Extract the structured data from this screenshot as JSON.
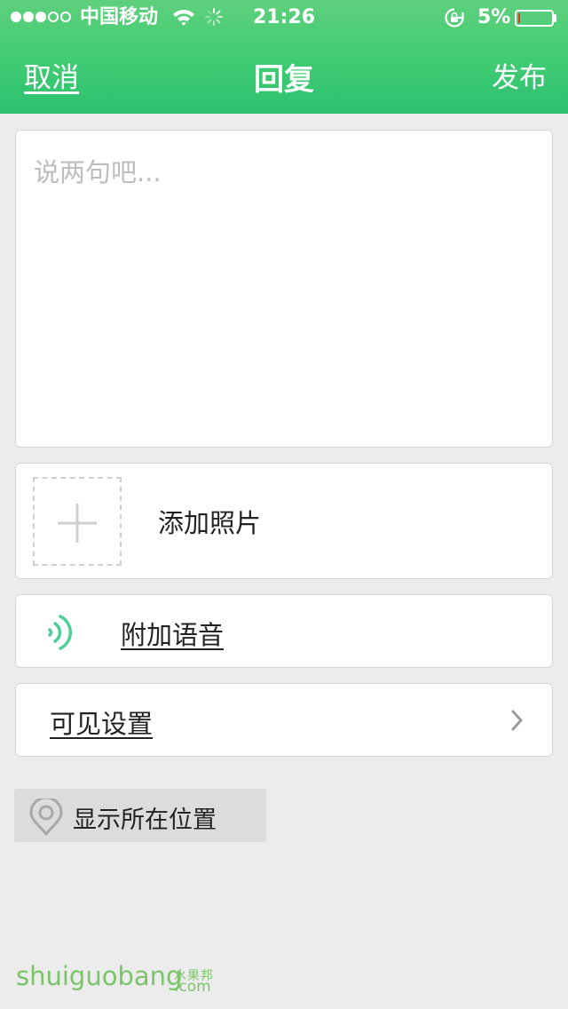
{
  "status_bar": {
    "carrier": "中国移动",
    "time": "21:26",
    "battery_percent": "5%",
    "battery_level": 0.05,
    "signal_bars_filled": 3,
    "signal_bars_total": 5
  },
  "nav": {
    "cancel_label": "取消",
    "title": "回复",
    "publish_label": "发布"
  },
  "compose": {
    "placeholder": "说两句吧...",
    "value": ""
  },
  "photo": {
    "label": "添加照片"
  },
  "voice": {
    "label": "附加语音"
  },
  "visibility": {
    "label": "可见设置"
  },
  "location": {
    "label": "显示所在位置"
  },
  "watermark": {
    "text": "shuiguobang",
    "cn_text": "水果邦",
    "domain": ".com"
  },
  "colors": {
    "header_top": "#5fd07d",
    "header_bottom": "#2ec170",
    "accent_voice": "#4ecf96",
    "background": "#ececec",
    "battery_low": "#e8312a"
  }
}
